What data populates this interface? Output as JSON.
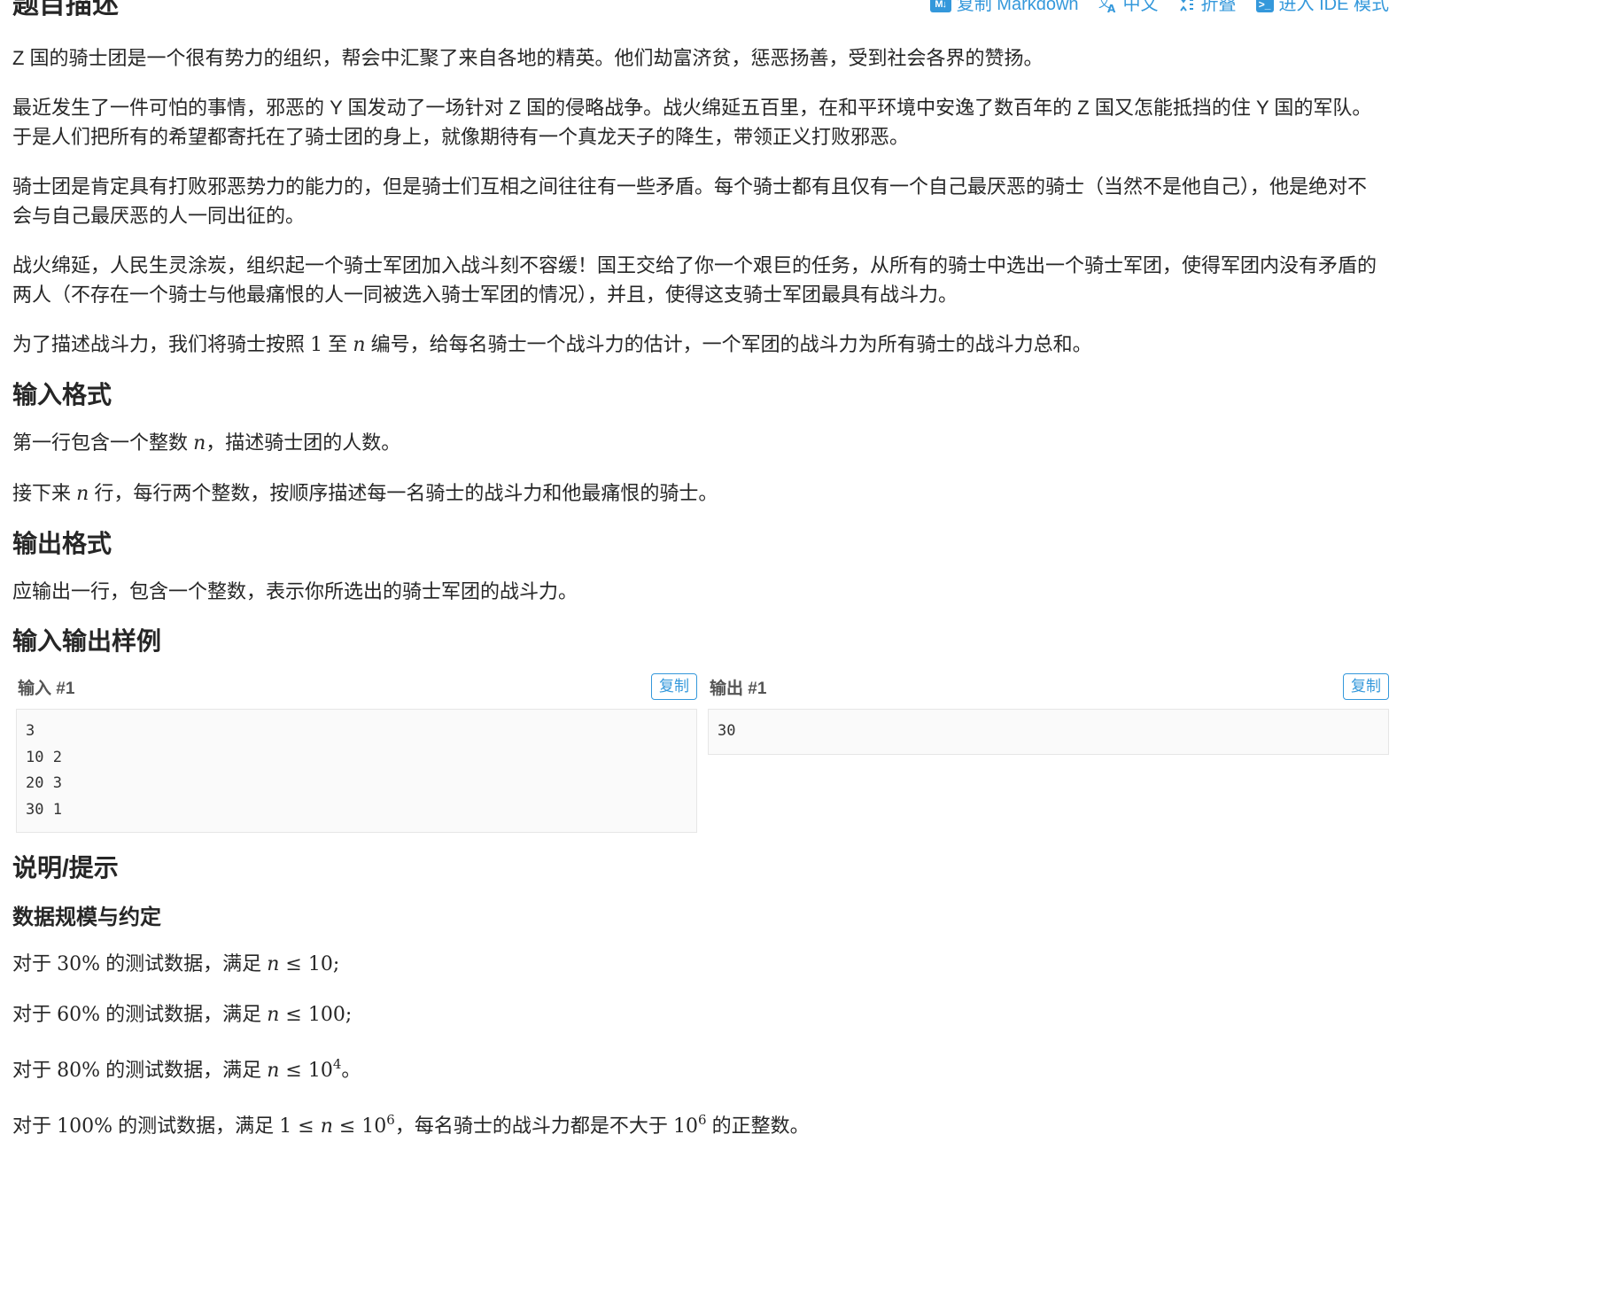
{
  "header": {
    "title": "题目描述",
    "actions": {
      "copy_markdown": "复制 Markdown",
      "language": "中文",
      "fold": "折叠",
      "ide_mode": "进入 IDE 模式"
    }
  },
  "description": {
    "p1": "Z 国的骑士团是一个很有势力的组织，帮会中汇聚了来自各地的精英。他们劫富济贫，惩恶扬善，受到社会各界的赞扬。",
    "p2_line1": "最近发生了一件可怕的事情，邪恶的 Y 国发动了一场针对 Z 国的侵略战争。战火绵延五百里，在和平环境中安逸了数百年的 Z 国又怎能抵挡的住 Y 国的军队。",
    "p2_line2": "于是人们把所有的希望都寄托在了骑士团的身上，就像期待有一个真龙天子的降生，带领正义打败邪恶。",
    "p3_line1": "骑士团是肯定具有打败邪恶势力的能力的，但是骑士们互相之间往往有一些矛盾。每个骑士都有且仅有一个自己最厌恶的骑士（当然不是他自己），他是绝对不",
    "p3_line2": "会与自己最厌恶的人一同出征的。",
    "p4_line1": "战火绵延，人民生灵涂炭，组织起一个骑士军团加入战斗刻不容缓！国王交给了你一个艰巨的任务，从所有的骑士中选出一个骑士军团，使得军团内没有矛盾的",
    "p4_line2": "两人（不存在一个骑士与他最痛恨的人一同被选入骑士军团的情况），并且，使得这支骑士军团最具有战斗力。",
    "p5_a": "为了描述战斗力，我们将骑士按照 ",
    "p5_one": "1",
    "p5_b": " 至 ",
    "p5_n": "n",
    "p5_c": " 编号，给每名骑士一个战斗力的估计，一个军团的战斗力为所有骑士的战斗力总和。"
  },
  "input_format": {
    "title": "输入格式",
    "l1_a": "第一行包含一个整数 ",
    "l1_n": "n",
    "l1_b": "，描述骑士团的人数。",
    "l2_a": "接下来 ",
    "l2_n": "n",
    "l2_b": " 行，每行两个整数，按顺序描述每一名骑士的战斗力和他最痛恨的骑士。"
  },
  "output_format": {
    "title": "输出格式",
    "l1": "应输出一行，包含一个整数，表示你所选出的骑士军团的战斗力。"
  },
  "samples": {
    "title": "输入输出样例",
    "input_title": "输入 #1",
    "output_title": "输出 #1",
    "copy_label": "复制",
    "input_lines": [
      "3",
      "10 2",
      "20 3",
      "30 1"
    ],
    "output_lines": [
      "30"
    ]
  },
  "hint": {
    "title": "说明/提示",
    "subtitle": "数据规模与约定",
    "r1_a": "对于 ",
    "r1_pct": "30%",
    "r1_b": " 的测试数据，满足 ",
    "r1_n": "n",
    "r1_le": " ≤ ",
    "r1_val": "10",
    "r1_end": ";",
    "r2_a": "对于 ",
    "r2_pct": "60%",
    "r2_b": " 的测试数据，满足 ",
    "r2_n": "n",
    "r2_le": " ≤ ",
    "r2_val": "100",
    "r2_end": ";",
    "r3_a": "对于 ",
    "r3_pct": "80%",
    "r3_b": " 的测试数据，满足 ",
    "r3_n": "n",
    "r3_le": " ≤ ",
    "r3_base": "10",
    "r3_exp": "4",
    "r3_end": "。",
    "r4_a": "对于 ",
    "r4_pct": "100%",
    "r4_b": " 的测试数据，满足 ",
    "r4_one": "1",
    "r4_le1": " ≤ ",
    "r4_n": "n",
    "r4_le2": " ≤ ",
    "r4_base": "10",
    "r4_exp": "6",
    "r4_c": "，每名骑士的战斗力都是不大于 ",
    "r4_base2": "10",
    "r4_exp2": "6",
    "r4_d": " 的正整数。"
  }
}
